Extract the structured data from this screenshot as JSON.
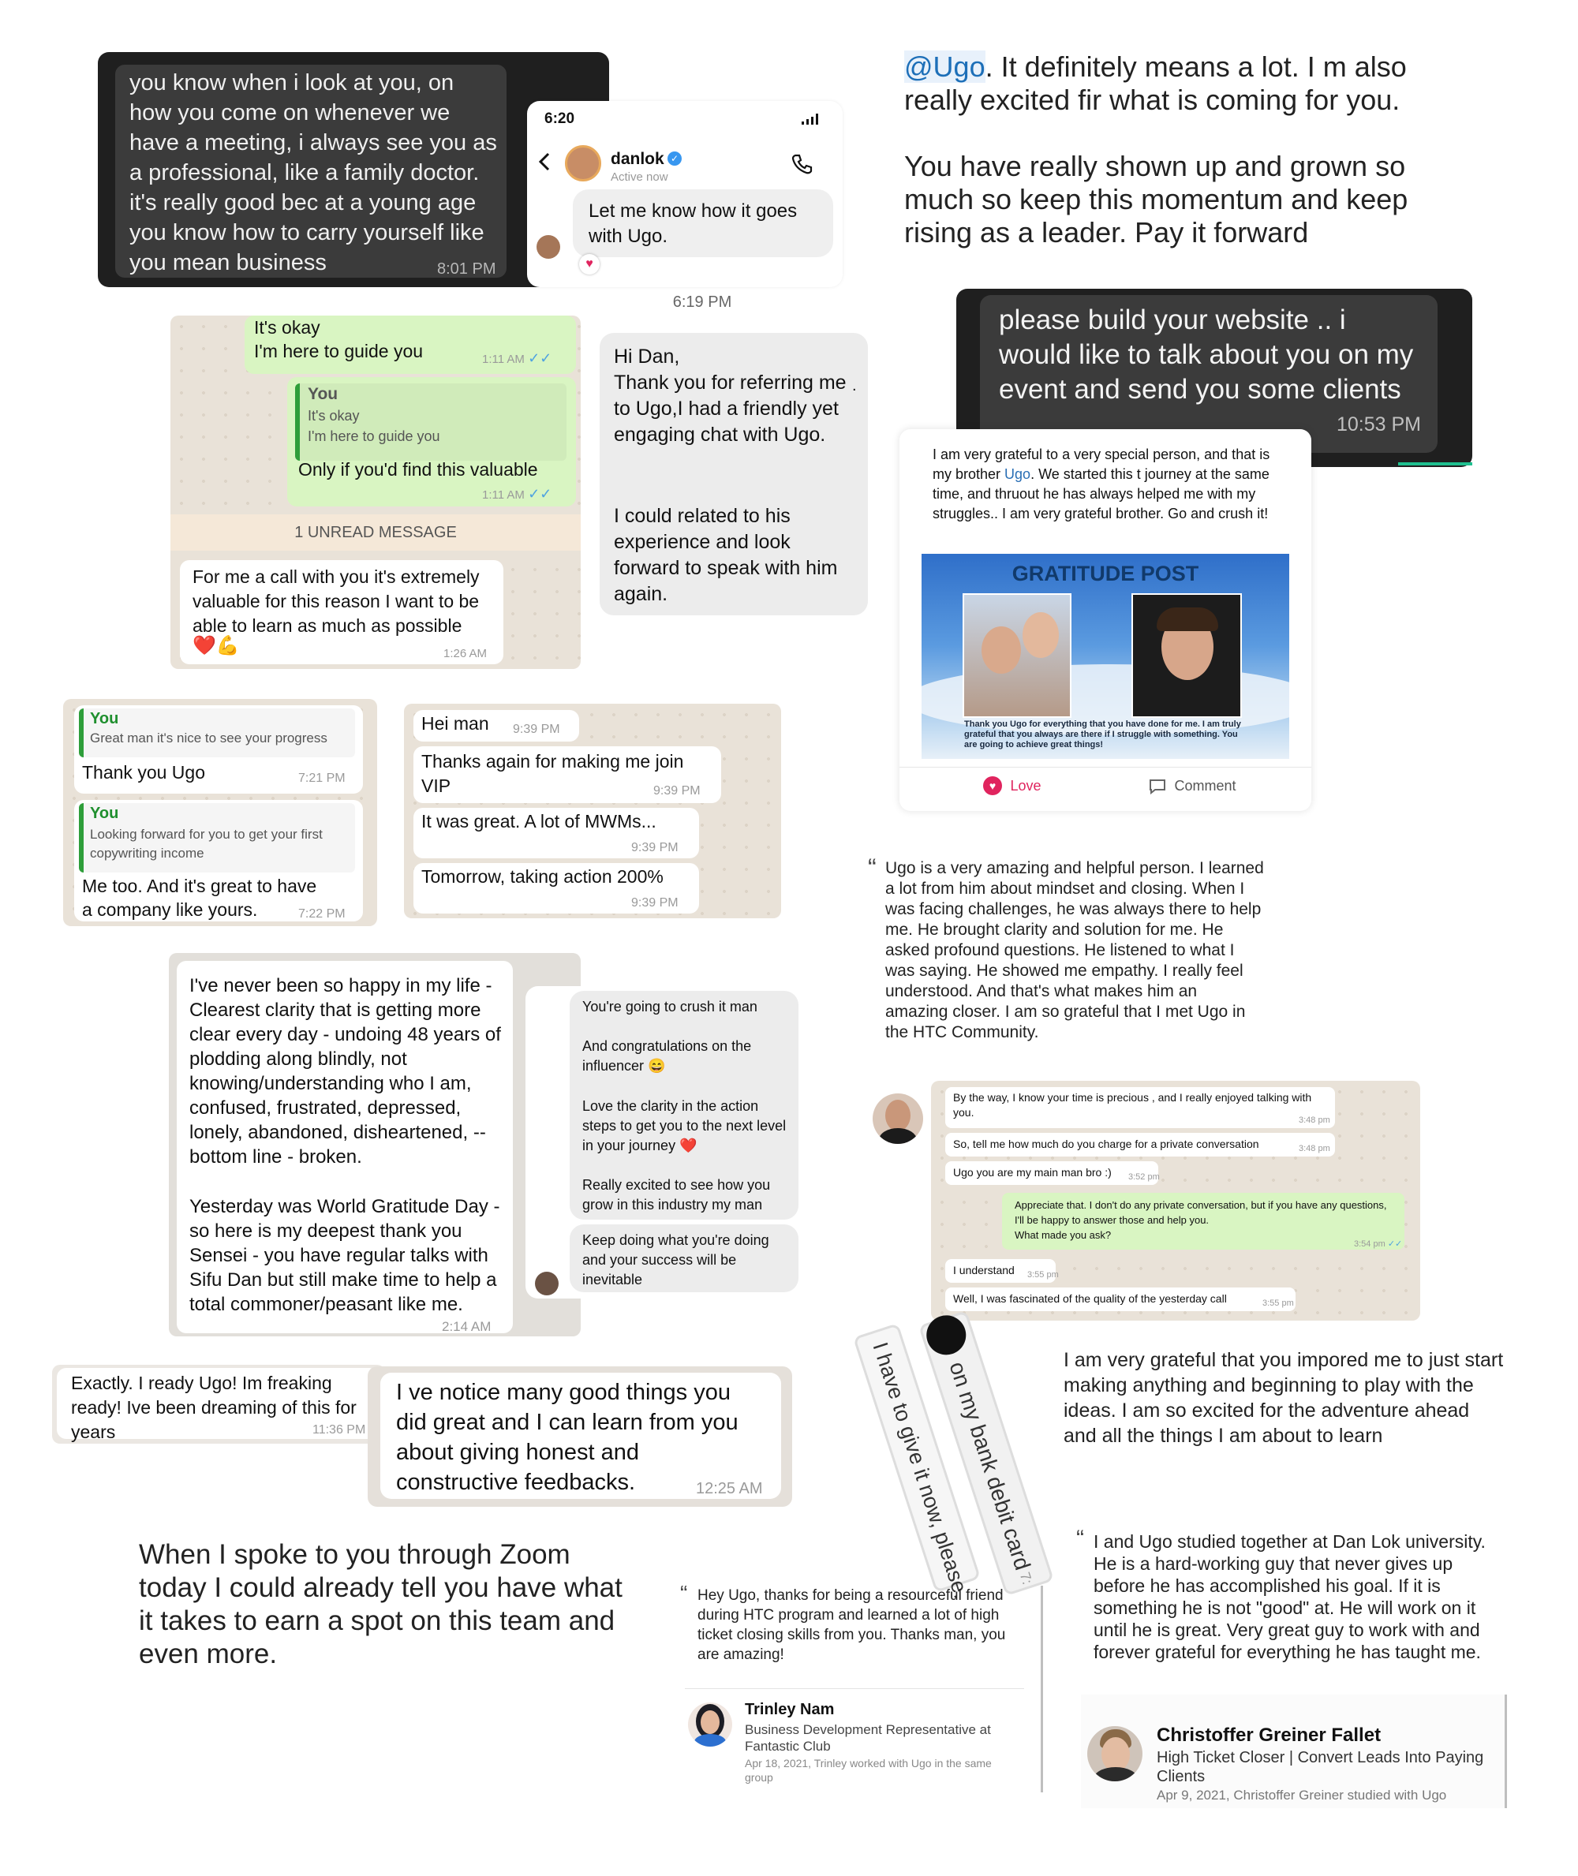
{
  "card1": {
    "text": "you know when i look at you, on how you come on whenever we have a meeting, i always see you as a professional, like a family doctor. it's really good bec at a young age you know how to carry yourself like you mean business",
    "time": "8:01 PM"
  },
  "card2": {
    "status_time": "6:20",
    "name": "danlok",
    "status": "Active now",
    "message": "Let me know how it goes with Ugo.",
    "reaction": "♥"
  },
  "card3": {
    "mention": "@Ugo",
    "text1": ".  It definitely means a lot.  I m also really excited fir what is coming for you.",
    "text2": "You have really shown up and grown so much so keep this momentum and keep rising as a leader. Pay it forward"
  },
  "card4": {
    "msg1": "It's okay\nI'm here to guide you",
    "time1": "1:11 AM",
    "quote_name": "You",
    "quote_text": "It's okay\nI'm here to guide you",
    "msg2": "Only if you'd find this valuable",
    "time2": "1:11 AM",
    "unread": "1 UNREAD MESSAGE",
    "msg3": "For me a call with you it's extremely valuable for this reason I want to be able to learn as much as possible",
    "emoji3": "❤️💪",
    "time3": "1:26 AM"
  },
  "card5": {
    "time": "6:19 PM",
    "text1": "Hi Dan,\nThank you for referring me to Ugo,I had a friendly yet engaging chat with Ugo.",
    "text2": "I could related to his experience and look forward to speak with him again.",
    "dot": "."
  },
  "card6": {
    "text": "please build your website .. i would like to talk about you on my event and send you some clients",
    "time": "10:53 PM"
  },
  "card7": {
    "text_a": "I am very grateful to a very special person, and that is my brother ",
    "link": "Ugo",
    "text_b": ". We started this t journey at the same time, and thruout he has always helped me with my struggles.. I am very grateful brother. Go and crush it!",
    "image_title": "GRATITUDE POST",
    "image_caption": "Thank you Ugo for everything that you have done for me. I am truly grateful that you always are there if I struggle with something. You are going to achieve great things!",
    "love": "Love",
    "comment": "Comment"
  },
  "card8": {
    "quote1_name": "You",
    "quote1_text": "Great man it's nice to see your progress",
    "msg1": "Thank you Ugo",
    "time1": "7:21 PM",
    "quote2_name": "You",
    "quote2_text": "Looking forward for you to get your first copywriting income",
    "msg2": "Me too. And it's great to have a company like yours.",
    "time2": "7:22 PM"
  },
  "card9": {
    "msgs": [
      {
        "text": "Hei man",
        "time": "9:39 PM"
      },
      {
        "text": "Thanks again for making me join VIP",
        "time": "9:39 PM"
      },
      {
        "text": "It was great. A lot of MWMs...",
        "time": "9:39 PM"
      },
      {
        "text": "Tomorrow, taking action 200%",
        "time": "9:39 PM"
      }
    ]
  },
  "card10": {
    "quote_mark": "“",
    "text": "Ugo is a very amazing and helpful person. I learned a lot from him about mindset and closing. When I was facing challenges, he was always there to help me. He brought clarity and solution for me. He asked profound questions. He listened to what I was saying. He showed me empathy. I really feel understood. And that's what makes him an amazing closer. I am so grateful that I met Ugo in the HTC Community."
  },
  "card11": {
    "text1": "I've never been so happy in my life - Clearest clarity that is getting more clear every day - undoing 48 years of plodding along blindly, not knowing/understanding who I am, confused, frustrated, depressed, lonely, abandoned, disheartened, -- bottom line - broken.",
    "text2": "Yesterday was World Gratitude Day - so here is my  deepest thank you Sensei - you have regular talks with Sifu Dan but still make time to help a total commoner/peasant like me.",
    "time": "2:14 AM"
  },
  "card12": {
    "bubble1": "You're going to crush it man",
    "bubble1b": "And congratulations on the influencer 😄",
    "bubble1c": "Love the clarity in the action steps to get you to the next level in your journey ❤️",
    "bubble1d": "Really excited to see how you grow in this industry my man",
    "bubble2": "Keep doing what you're doing and your success will be inevitable"
  },
  "card13": {
    "msgs": [
      {
        "text": "By the way, I know your time is precious , and I really enjoyed talking with you.",
        "time": "3:48 pm"
      },
      {
        "text": "So, tell me how much do you charge for a private conversation",
        "time": "3:48 pm"
      },
      {
        "text": "Ugo you are my main man bro :)",
        "time": "3:52 pm"
      }
    ],
    "reply": "Appreciate that. I don't do any private conversation, but if you have any questions, I'll be happy to answer those and help you.\nWhat made you ask?",
    "reply_time": "3:54 pm",
    "msgs2": [
      {
        "text": "I understand",
        "time": "3:55 pm"
      },
      {
        "text": "Well, I was fascinated of the quality of the yesterday call",
        "time": "3:55 pm"
      }
    ]
  },
  "card14": {
    "text": "Exactly. I ready Ugo! Im freaking ready! Ive been dreaming of this for years",
    "time": "11:36 PM"
  },
  "card15": {
    "text": "I ve notice many good things you did great and I can learn from you about giving honest and constructive feedbacks.",
    "time": "12:25 AM"
  },
  "card16": {
    "line1": "on my bank debit card",
    "line2": "I have to give it now, please.",
    "time": "7:"
  },
  "card17": {
    "text": "I am very grateful that you impored me to just start making anything and beginning to play with the ideas.  I am so excited for the adventure ahead\nand all the things I am about to learn"
  },
  "card18": {
    "text": "When I spoke to you through Zoom today I could already tell you have what it takes to earn a spot on this team and even more."
  },
  "card19": {
    "quote_mark": "“",
    "text": "Hey Ugo, thanks for being a resourceful friend during HTC program and learned a lot of high ticket closing skills from you. Thanks man, you are amazing!",
    "name": "Trinley Nam",
    "title": "Business Development Representative at Fantastic Club",
    "meta": "Apr 18, 2021, Trinley worked with Ugo in the same group"
  },
  "card20": {
    "quote_mark": "“",
    "text": "I and Ugo studied together at Dan Lok university. He is a hard-working guy that never gives up before he has accomplished his goal. If it is something he is not \"good\" at. He will work on it until he is great. Very great guy to work with and forever grateful for everything he has taught me.",
    "name": "Christoffer Greiner Fallet",
    "title": "High Ticket Closer | Convert Leads Into Paying Clients",
    "meta": "Apr 9, 2021, Christoffer Greiner studied with Ugo"
  },
  "colors": {
    "whatsapp_green": "#d9f5c2",
    "link_blue": "#2a6fb5",
    "dark_bubble": "#3a3a3a",
    "love_red": "#e0245e"
  }
}
